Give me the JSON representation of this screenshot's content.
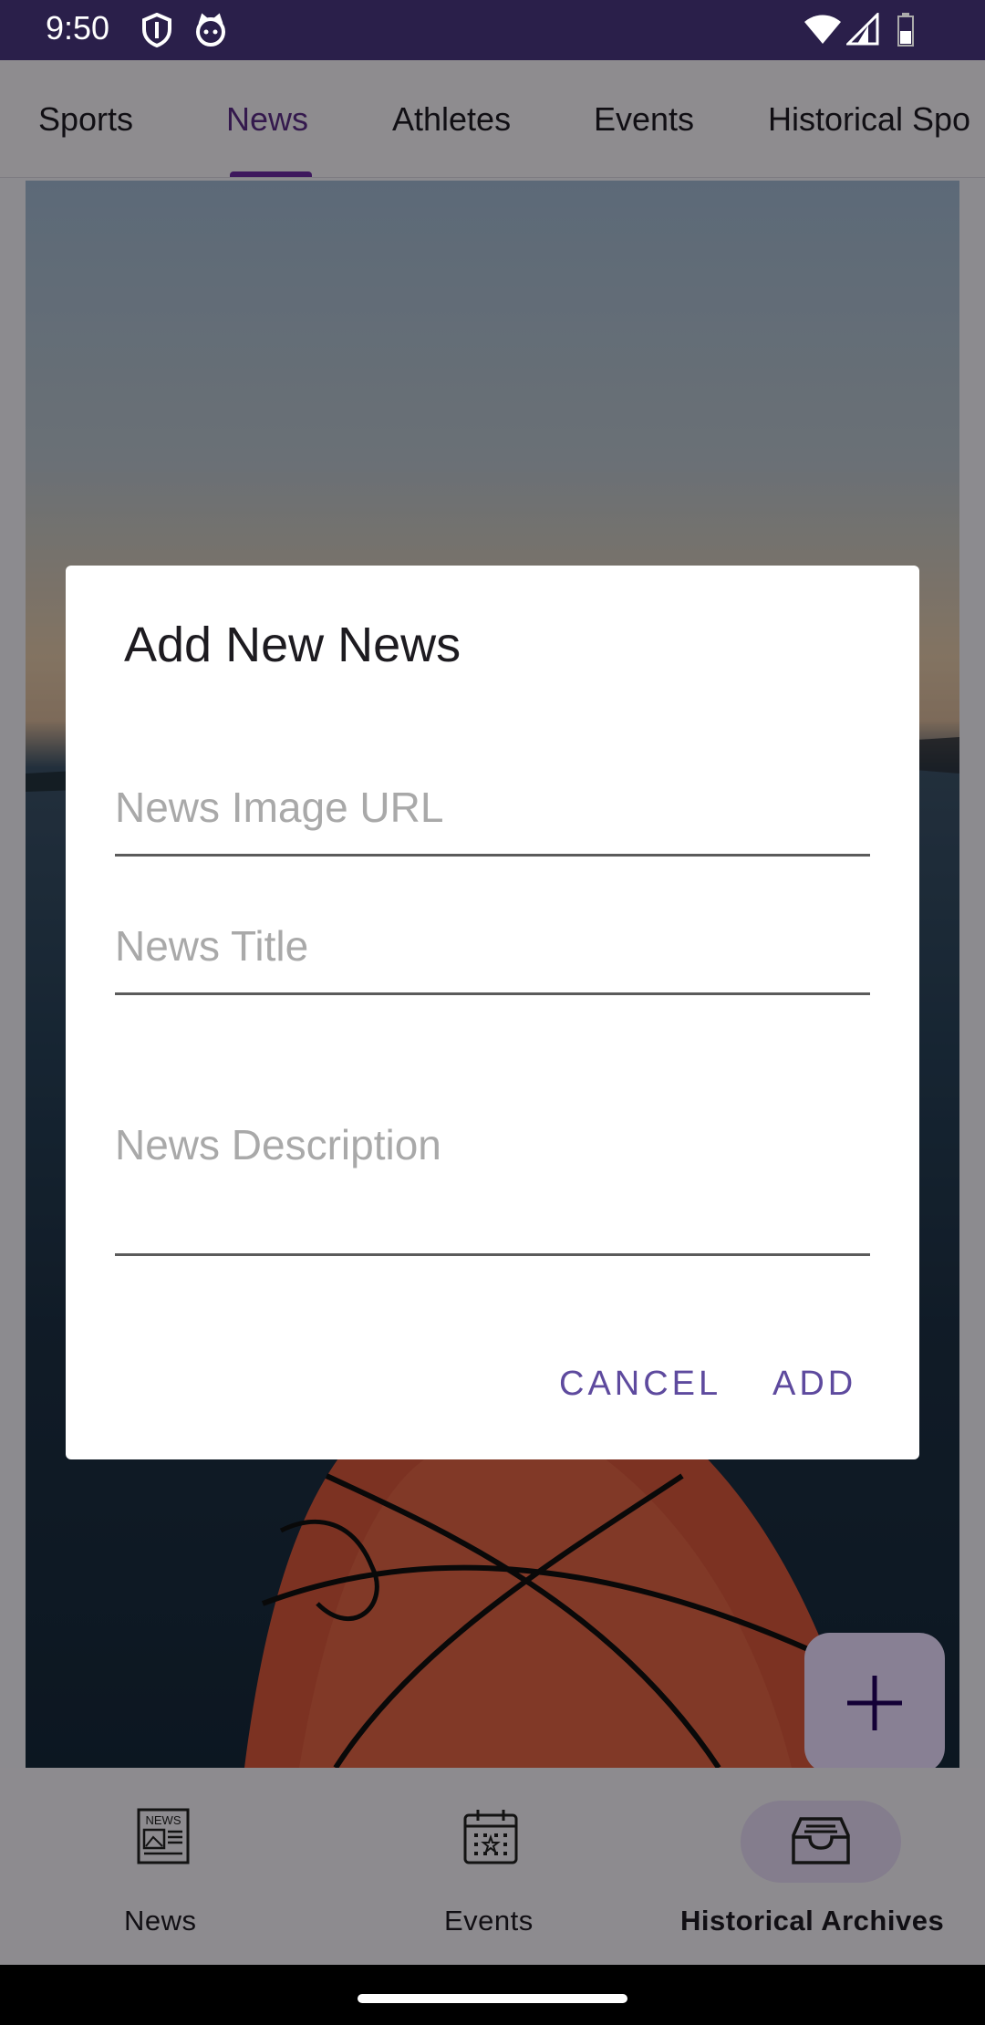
{
  "status_bar": {
    "time": "9:50",
    "icons": [
      "shield-icon",
      "cat-face-icon",
      "wifi-icon",
      "signal-icon",
      "battery-icon"
    ]
  },
  "top_tabs": {
    "items": [
      {
        "label": "Sports"
      },
      {
        "label": "News"
      },
      {
        "label": "Athletes"
      },
      {
        "label": "Events"
      },
      {
        "label": "Historical Spo"
      }
    ],
    "active_index": 1
  },
  "dialog": {
    "title": "Add New News",
    "fields": {
      "image_url": {
        "value": "",
        "placeholder": "News Image URL"
      },
      "title": {
        "value": "",
        "placeholder": "News Title"
      },
      "description": {
        "value": "",
        "placeholder": "News Description"
      }
    },
    "cancel_label": "CANCEL",
    "add_label": "ADD"
  },
  "fab": {
    "icon": "plus-icon"
  },
  "bottom_nav": {
    "items": [
      {
        "label": "News",
        "icon": "newspaper-icon"
      },
      {
        "label": "Events",
        "icon": "calendar-icon"
      },
      {
        "label": "Historical Archives",
        "icon": "archive-inbox-icon"
      }
    ],
    "active_index": 2
  },
  "colors": {
    "accent": "#5e4a9e",
    "status_bar": "#2a1f4a",
    "active_tab": "#5b2b86"
  }
}
